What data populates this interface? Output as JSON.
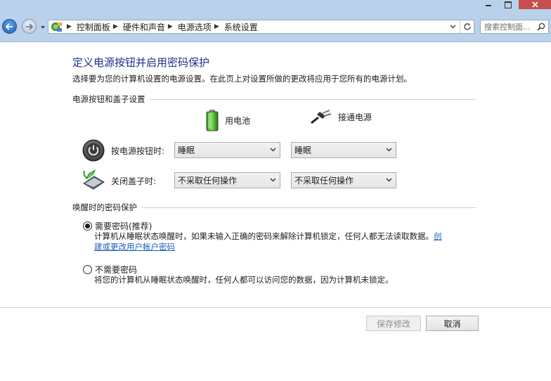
{
  "window": {
    "minimize_label": "",
    "maximize_label": "",
    "close_label": ""
  },
  "nav": {
    "breadcrumb": [
      "控制面板",
      "硬件和声音",
      "电源选项",
      "系统设置"
    ],
    "search_placeholder": "搜索控制面..."
  },
  "page": {
    "title": "定义电源按钮并启用密码保护",
    "description": "选择要为您的计算机设置的电源设置。在此页上对设置所做的更改将应用于您所有的电源计划。"
  },
  "power_section": {
    "heading": "电源按钮和盖子设置",
    "col_battery": "用电池",
    "col_plugged": "接通电源",
    "rows": [
      {
        "label": "按电源按钮时:",
        "battery": "睡眠",
        "plugged": "睡眠"
      },
      {
        "label": "关闭盖子时:",
        "battery": "不采取任何操作",
        "plugged": "不采取任何操作"
      }
    ]
  },
  "password_section": {
    "heading": "唤醒时的密码保护",
    "options": [
      {
        "label": "需要密码(推荐)",
        "selected": true,
        "desc": "计算机从睡眠状态唤醒时，如果未输入正确的密码来解除计算机锁定，任何人都无法读取数据。",
        "link_1": "创",
        "link_2": "建或更改用户帐户密码"
      },
      {
        "label": "不需要密码",
        "selected": false,
        "desc": "将您的计算机从睡眠状态唤醒时，任何人都可以访问您的数据，因为计算机未锁定。"
      }
    ]
  },
  "footer": {
    "save_label": "保存修改",
    "cancel_label": "取消"
  },
  "colors": {
    "chrome": "#b9d1ea",
    "title": "#1e3287",
    "link": "#1c5fbd",
    "close": "#c74e4e"
  }
}
